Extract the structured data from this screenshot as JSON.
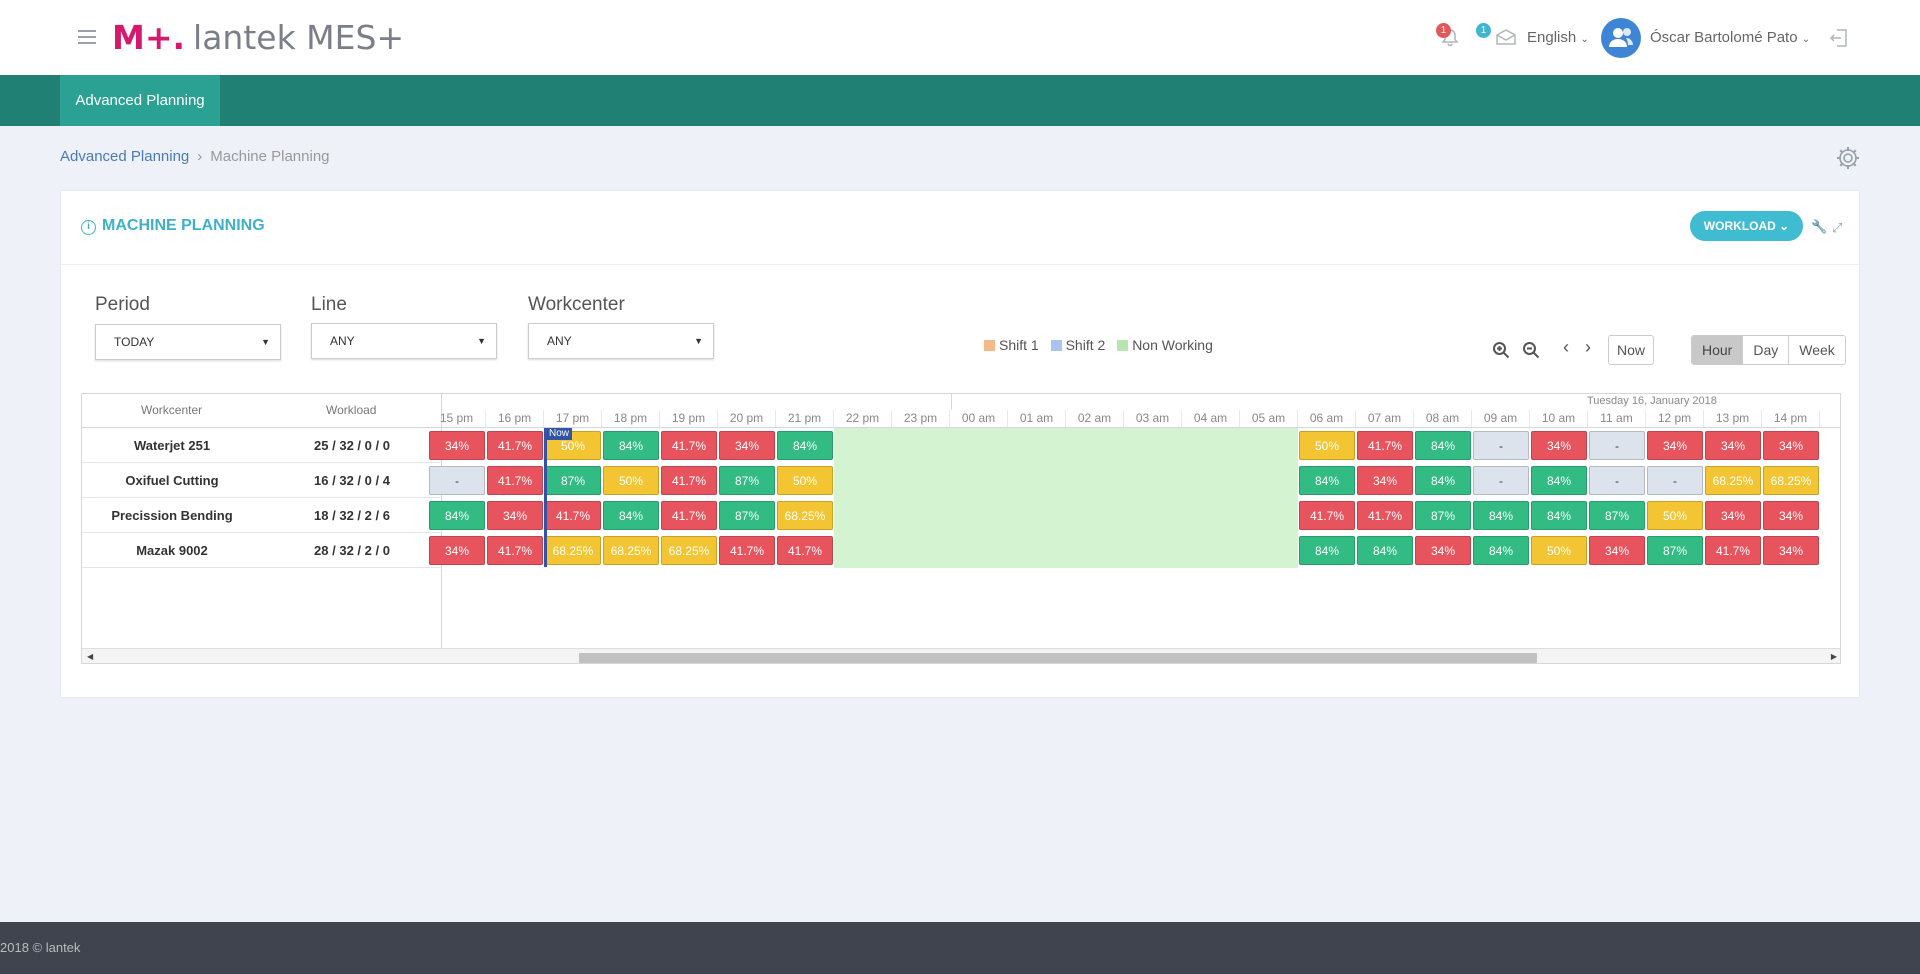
{
  "header": {
    "logo_mark": "M+.",
    "logo_text": "lantek MES+",
    "notif_count": "1",
    "msg_count": "1",
    "language": "English",
    "user": "Óscar Bartolomé Pato"
  },
  "nav": {
    "tab": "Advanced Planning"
  },
  "breadcrumb": {
    "parent": "Advanced Planning",
    "current": "Machine Planning"
  },
  "card": {
    "title": "MACHINE PLANNING",
    "mode_button": "WORKLOAD"
  },
  "filters": {
    "period": {
      "label": "Period",
      "value": "TODAY"
    },
    "line": {
      "label": "Line",
      "value": "ANY"
    },
    "workcenter": {
      "label": "Workcenter",
      "value": "ANY"
    }
  },
  "legend": {
    "shift1": "Shift 1",
    "shift2": "Shift 2",
    "nonworking": "Non Working",
    "colors": {
      "shift1": "#f5b98a",
      "shift2": "#a9c4ee",
      "nonworking": "#b8e6b0"
    }
  },
  "toolbar": {
    "now": "Now",
    "views": [
      "Hour",
      "Day",
      "Week"
    ],
    "active_view": "Hour"
  },
  "grid": {
    "col_workcenter": "Workcenter",
    "col_workload": "Workload",
    "day_label": "Tuesday 16, January 2018",
    "now_label": "Now",
    "hours": [
      "15 pm",
      "16 pm",
      "17 pm",
      "18 pm",
      "19 pm",
      "20 pm",
      "21 pm",
      "22 pm",
      "23 pm",
      "00 am",
      "01 am",
      "02 am",
      "03 am",
      "04 am",
      "05 am",
      "06 am",
      "07 am",
      "08 am",
      "09 am",
      "10 am",
      "11 am",
      "12 pm",
      "13 pm",
      "14 pm"
    ],
    "rows": [
      {
        "workcenter": "Waterjet 251",
        "workload": "25 / 32 / 0 / 0",
        "cells": [
          [
            "34%",
            "red"
          ],
          [
            "41.7%",
            "red"
          ],
          [
            "50%",
            "yellow"
          ],
          [
            "84%",
            "green"
          ],
          [
            "41.7%",
            "red"
          ],
          [
            "34%",
            "red"
          ],
          [
            "84%",
            "green"
          ],
          null,
          null,
          null,
          null,
          null,
          null,
          null,
          null,
          [
            "50%",
            "yellow"
          ],
          [
            "41.7%",
            "red"
          ],
          [
            "84%",
            "green"
          ],
          [
            "-",
            "gray"
          ],
          [
            "34%",
            "red"
          ],
          [
            "-",
            "gray"
          ],
          [
            "34%",
            "red"
          ],
          [
            "34%",
            "red"
          ],
          [
            "34%",
            "red"
          ]
        ]
      },
      {
        "workcenter": "Oxifuel Cutting",
        "workload": "16 / 32 / 0 / 4",
        "cells": [
          [
            "-",
            "gray"
          ],
          [
            "41.7%",
            "red"
          ],
          [
            "87%",
            "green"
          ],
          [
            "50%",
            "yellow"
          ],
          [
            "41.7%",
            "red"
          ],
          [
            "87%",
            "green"
          ],
          [
            "50%",
            "yellow"
          ],
          null,
          null,
          null,
          null,
          null,
          null,
          null,
          null,
          [
            "84%",
            "green"
          ],
          [
            "34%",
            "red"
          ],
          [
            "84%",
            "green"
          ],
          [
            "-",
            "gray"
          ],
          [
            "84%",
            "green"
          ],
          [
            "-",
            "gray"
          ],
          [
            "-",
            "gray"
          ],
          [
            "68.25%",
            "yellow"
          ],
          [
            "68.25%",
            "yellow"
          ]
        ]
      },
      {
        "workcenter": "Precission Bending",
        "workload": "18 / 32 / 2 / 6",
        "cells": [
          [
            "84%",
            "green"
          ],
          [
            "34%",
            "red"
          ],
          [
            "41.7%",
            "red"
          ],
          [
            "84%",
            "green"
          ],
          [
            "41.7%",
            "red"
          ],
          [
            "87%",
            "green"
          ],
          [
            "68.25%",
            "yellow"
          ],
          null,
          null,
          null,
          null,
          null,
          null,
          null,
          null,
          [
            "41.7%",
            "red"
          ],
          [
            "41.7%",
            "red"
          ],
          [
            "87%",
            "green"
          ],
          [
            "84%",
            "green"
          ],
          [
            "84%",
            "green"
          ],
          [
            "87%",
            "green"
          ],
          [
            "50%",
            "yellow"
          ],
          [
            "34%",
            "red"
          ],
          [
            "34%",
            "red"
          ]
        ]
      },
      {
        "workcenter": "Mazak 9002",
        "workload": "28 / 32 / 2 / 0",
        "cells": [
          [
            "34%",
            "red"
          ],
          [
            "41.7%",
            "red"
          ],
          [
            "68.25%",
            "yellow"
          ],
          [
            "68.25%",
            "yellow"
          ],
          [
            "68.25%",
            "yellow"
          ],
          [
            "41.7%",
            "red"
          ],
          [
            "41.7%",
            "red"
          ],
          null,
          null,
          null,
          null,
          null,
          null,
          null,
          null,
          [
            "84%",
            "green"
          ],
          [
            "84%",
            "green"
          ],
          [
            "34%",
            "red"
          ],
          [
            "84%",
            "green"
          ],
          [
            "50%",
            "yellow"
          ],
          [
            "34%",
            "red"
          ],
          [
            "87%",
            "green"
          ],
          [
            "41.7%",
            "red"
          ],
          [
            "34%",
            "red"
          ]
        ]
      }
    ]
  },
  "footer": {
    "text": "2018 © lantek"
  }
}
